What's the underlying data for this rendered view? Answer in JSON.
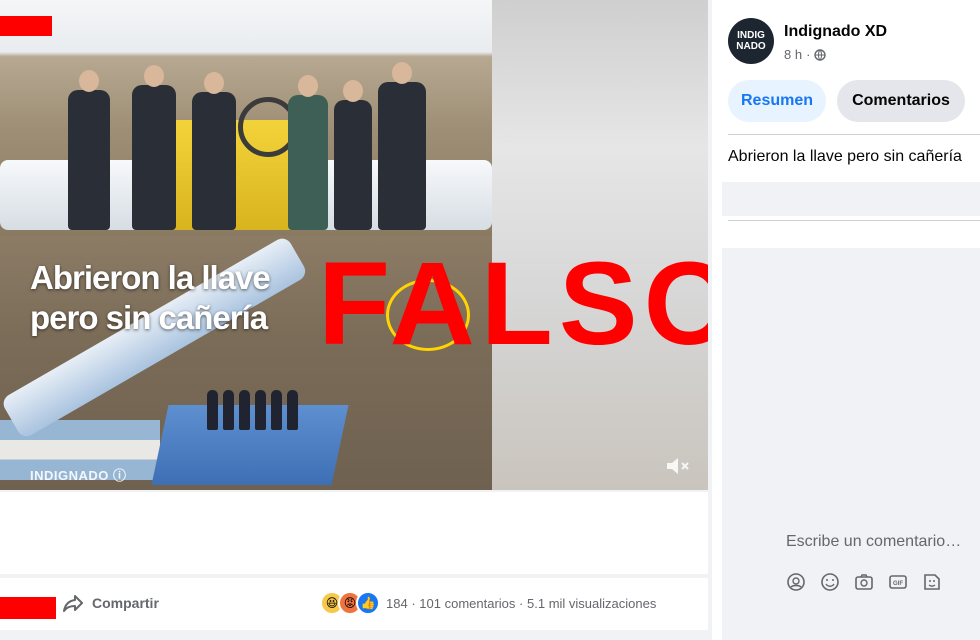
{
  "video": {
    "overlay_caption": "Abrieron la llave\npero sin cañería",
    "watermark": "INDIGNADO",
    "stamp": "FALSO"
  },
  "post": {
    "author": "Indignado XD",
    "avatar_text": "INDIG\nNADO",
    "time": "8 h",
    "separator": "·",
    "caption": "Abrieron la llave pero sin cañería",
    "tabs": {
      "summary": "Resumen",
      "comments": "Comentarios"
    }
  },
  "actions": {
    "share_label": "Compartir",
    "reaction_count": "184",
    "comments_count": "101 comentarios",
    "views": "5.1 mil visualizaciones",
    "dot": "·"
  },
  "comment_composer": {
    "placeholder": "Escribe un comentario…"
  },
  "colors": {
    "accent": "#1877f2",
    "stamp": "#ff0000",
    "background": "#f0f2f5"
  },
  "icons": [
    "globe-icon",
    "share-icon",
    "haha-icon",
    "angry-icon",
    "like-icon",
    "mute-icon",
    "avatar-sticker-icon",
    "emoji-icon",
    "camera-icon",
    "gif-icon",
    "sticker-icon"
  ]
}
